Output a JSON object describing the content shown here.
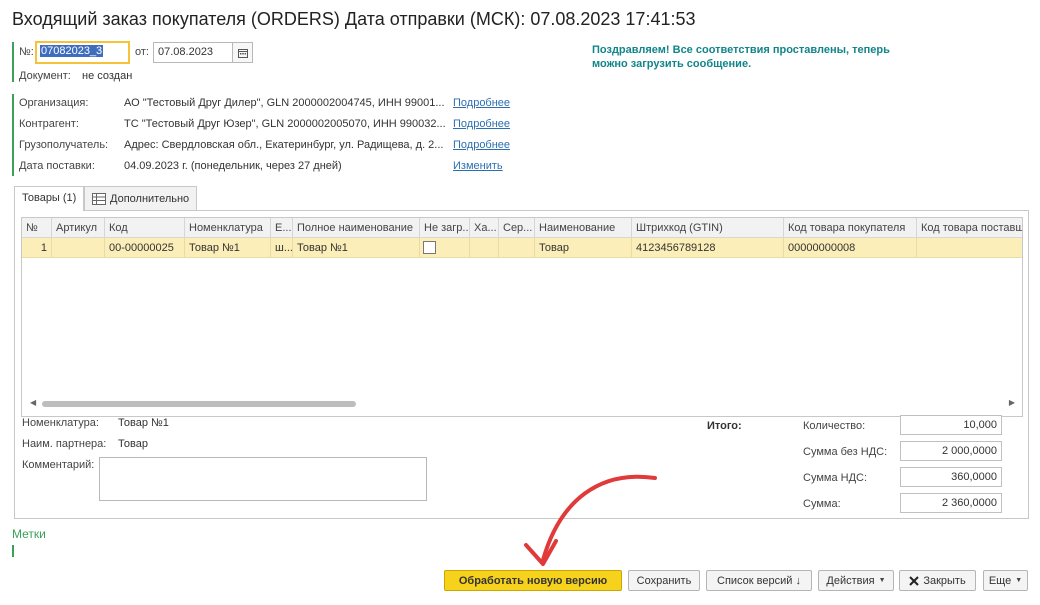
{
  "header": {
    "title": "Входящий заказ покупателя (ORDERS) Дата отправки (МСК): 07.08.2023 17:41:53",
    "number_label": "№:",
    "number_value": "07082023_3",
    "date_label": "от:",
    "date_value": "07.08.2023",
    "document_label": "Документ:",
    "document_value": "не создан",
    "message": "Поздравляем! Все соответствия проставлены, теперь можно загрузить сообщение."
  },
  "details": [
    {
      "label": "Организация:",
      "value": "АО \"Тестовый Друг Дилер\", GLN 2000002004745, ИНН 99001...",
      "link": "Подробнее"
    },
    {
      "label": "Контрагент:",
      "value": "ТС \"Тестовый Друг Юзер\", GLN 2000002005070, ИНН 990032...",
      "link": "Подробнее"
    },
    {
      "label": "Грузополучатель:",
      "value": "Адрес: Свердловская обл., Екатеринбург, ул. Радищева, д. 2...",
      "link": "Подробнее"
    },
    {
      "label": "Дата поставки:",
      "value": "04.09.2023 г. (понедельник, через 27 дней)",
      "link": "Изменить"
    }
  ],
  "tabs": [
    {
      "label": "Товары (1)"
    },
    {
      "label": "Дополнительно",
      "icon": "table-icon"
    }
  ],
  "table": {
    "columns": [
      "№",
      "Артикул",
      "Код",
      "Номенклатура",
      "Е...",
      "Полное наименование",
      "Не загр...",
      "Ха...",
      "Сер...",
      "Наименование",
      "Штрихкод (GTIN)",
      "Код товара покупателя",
      "Код товара поставщ"
    ],
    "rows": [
      [
        "1",
        "",
        "00-00000025",
        "Товар №1",
        "ш...",
        "Товар №1",
        "",
        "",
        "",
        "Товар",
        "4123456789128",
        "00000000008",
        ""
      ]
    ]
  },
  "footer_info": {
    "nomenclature_label": "Номенклатура:",
    "nomenclature_value": "Товар №1",
    "partner_label": "Наим. партнера:",
    "partner_value": "Товар",
    "comment_label": "Комментарий:"
  },
  "totals": {
    "title": "Итого:",
    "items": [
      {
        "label": "Количество:",
        "value": "10,000"
      },
      {
        "label": "Сумма без НДС:",
        "value": "2 000,0000"
      },
      {
        "label": "Сумма НДС:",
        "value": "360,0000"
      },
      {
        "label": "Сумма:",
        "value": "2 360,0000"
      }
    ]
  },
  "labels_section": "Метки",
  "buttons": {
    "process": "Обработать новую версию",
    "save": "Сохранить",
    "versions": "Список версий ↓",
    "actions": "Действия",
    "close": "Закрыть",
    "more": "Еще"
  },
  "colors": {
    "accent_green": "#3aa05a",
    "message_teal": "#12858a",
    "primary_button": "#f7d21c",
    "selected_row": "#fbeeb9",
    "link_blue": "#2c6fb0",
    "annotation_arrow": "#e03a3a"
  }
}
